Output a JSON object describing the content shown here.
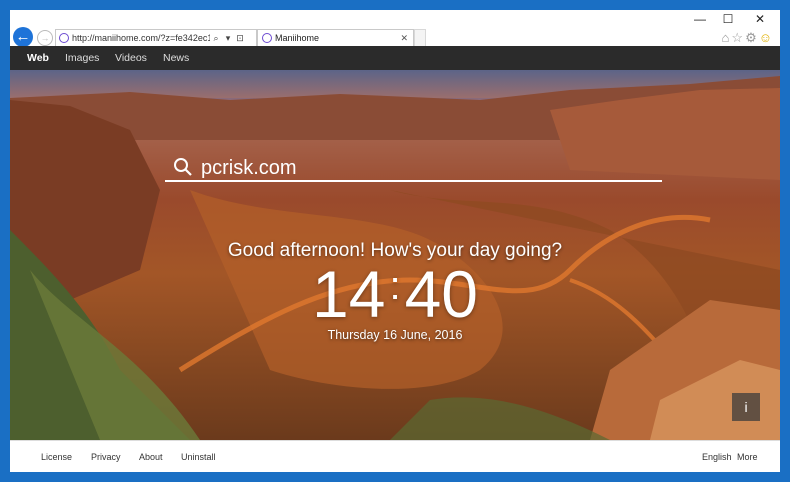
{
  "browser": {
    "address": {
      "url": "http://maniihome.com/?z=fe342ec1-"
    },
    "tab": {
      "title": "Maniihome"
    }
  },
  "nav": {
    "items": [
      "Web",
      "Images",
      "Videos",
      "News"
    ]
  },
  "search": {
    "value": "pcrisk.com"
  },
  "greeting": "Good afternoon! How's your day going?",
  "clock": {
    "hours": "14",
    "minutes": "40"
  },
  "date": "Thursday 16 June, 2016",
  "info_button": "i",
  "footer": {
    "links": [
      "License",
      "Privacy",
      "About",
      "Uninstall"
    ],
    "language": "English",
    "more": "More"
  }
}
